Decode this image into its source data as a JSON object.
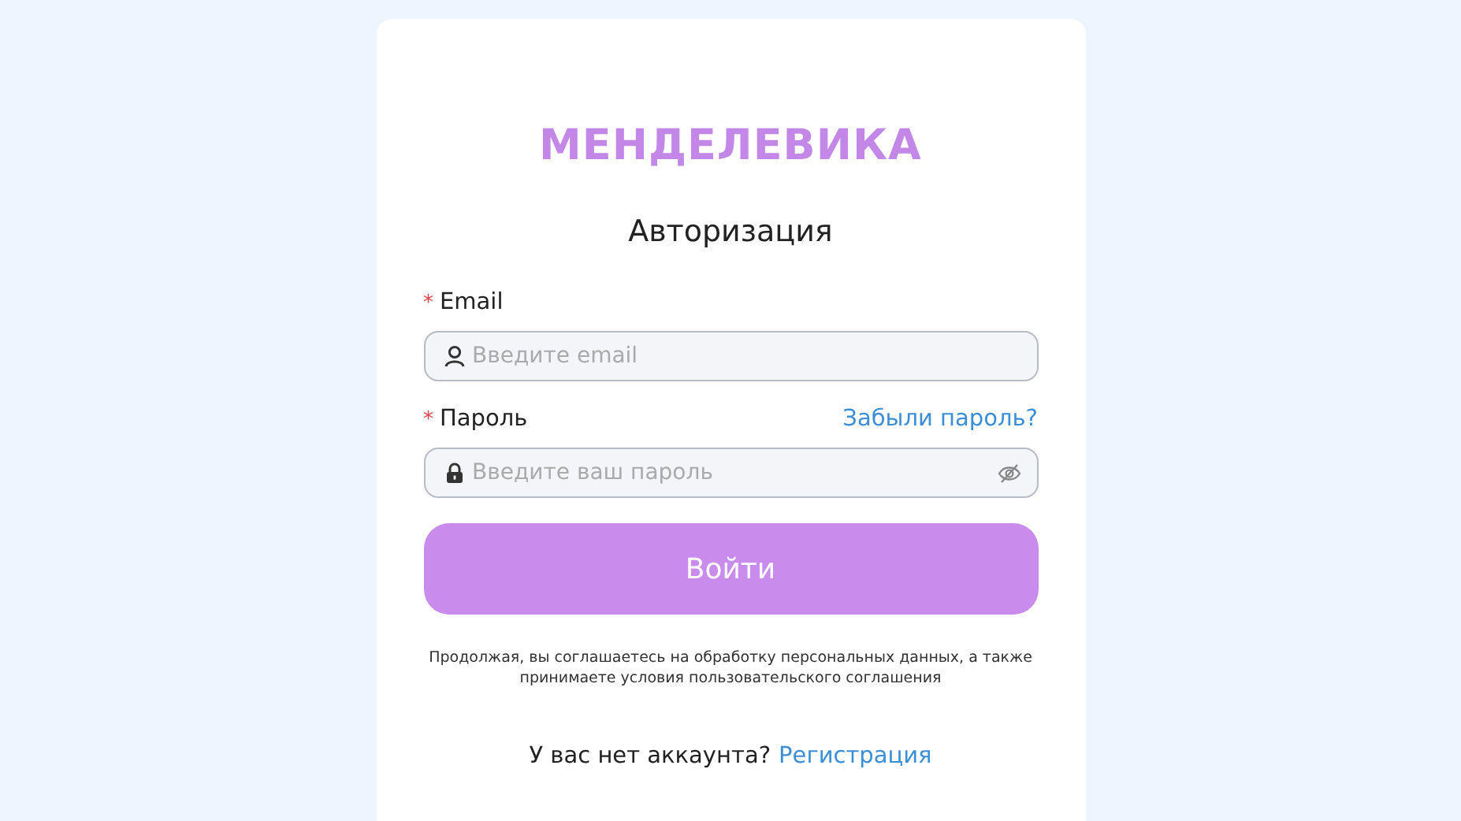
{
  "logo": "МЕНДЕЛЕВИКА",
  "title": "Авторизация",
  "fields": [
    {
      "kind": "email",
      "required_mark": "*",
      "label": "Email",
      "placeholder": "Введите email"
    },
    {
      "kind": "password",
      "required_mark": "*",
      "label": "Пароль",
      "link": "Забыли пароль?",
      "placeholder": "Введите ваш пароль"
    }
  ],
  "submit": "Войти",
  "legal": "Продолжая, вы соглашаетесь на обработку персональных данных, а также принимаете условия пользовательского соглашения",
  "signup": {
    "text": "У вас нет аккаунта?",
    "link": "Регистрация"
  }
}
